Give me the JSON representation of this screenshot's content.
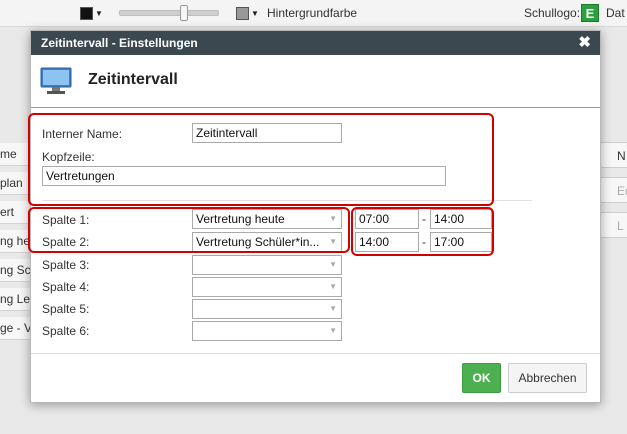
{
  "toolbar": {
    "background_color_label": "Hintergrundfarbe",
    "school_logo_label": "Schullogo:",
    "logo_letter": "E",
    "cut_label": "Dat",
    "text_color": "#111111",
    "bg_color": "#999999"
  },
  "background": {
    "rows": [
      "me",
      "plan",
      "ert",
      "ng he",
      "ng Sch",
      "ng Leh",
      "ge - V"
    ],
    "right_buttons": [
      "N",
      "Ed",
      "L"
    ]
  },
  "dialog": {
    "title": "Zeitintervall - Einstellungen",
    "close_glyph": "✖",
    "header_title": "Zeitintervall",
    "header_icon": "monitor-icon",
    "internal_name_label": "Interner Name:",
    "internal_name_value": "Zeitintervall",
    "header_label": "Kopfzeile:",
    "header_value": "Vertretungen",
    "columns": [
      {
        "label": "Spalte 1:",
        "value": "Vertretung heute",
        "from": "07:00",
        "to": "14:00"
      },
      {
        "label": "Spalte 2:",
        "value": "Vertretung Schüler*in...",
        "from": "14:00",
        "to": "17:00"
      },
      {
        "label": "Spalte 3:",
        "value": ""
      },
      {
        "label": "Spalte 4:",
        "value": ""
      },
      {
        "label": "Spalte 5:",
        "value": ""
      },
      {
        "label": "Spalte 6:",
        "value": ""
      }
    ],
    "time_separator": "-",
    "ok_label": "OK",
    "cancel_label": "Abbrechen"
  },
  "colors": {
    "titlebar": "#3c4850",
    "ok_button": "#4caf50",
    "highlight": "#d40000"
  }
}
